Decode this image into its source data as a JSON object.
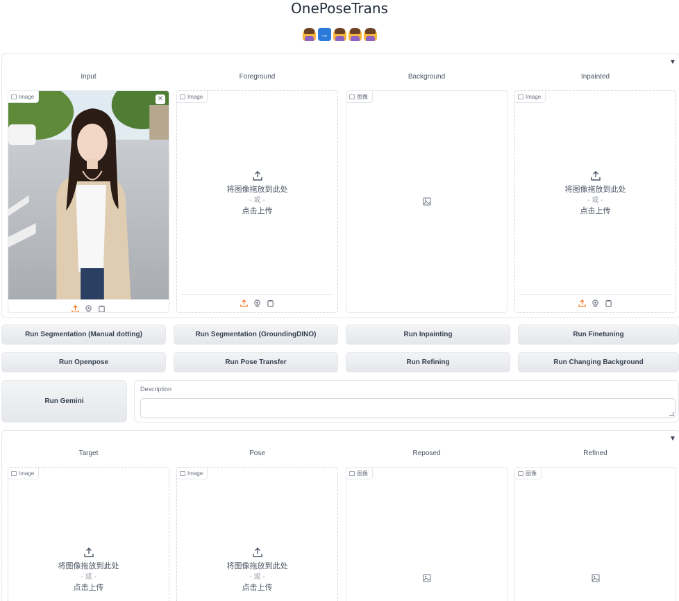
{
  "app": {
    "title": "OnePoseTrans"
  },
  "emojis": [
    "person-with-veil-emoji",
    "right-arrow-emoji",
    "person-standing-emoji",
    "person-gesturing-emoji",
    "person-raising-hand-emoji"
  ],
  "colors": {
    "accent": "#f97316",
    "border": "#e5e7eb",
    "button_bg": "#e5e7eb"
  },
  "section1": {
    "collapse_glyph": "▼",
    "columns": [
      {
        "label": "Input",
        "tag": "Image",
        "state": "filled"
      },
      {
        "label": "Foreground",
        "tag": "Image",
        "state": "upload"
      },
      {
        "label": "Background",
        "tag": "图像",
        "state": "empty"
      },
      {
        "label": "Inpainted",
        "tag": "Image",
        "state": "upload"
      }
    ]
  },
  "upload": {
    "line1": "将图像拖放到此处",
    "line2": "- 或 -",
    "line3": "点击上传"
  },
  "buttons": {
    "seg_manual": "Run Segmentation (Manual dotting)",
    "seg_grounding": "Run Segmentation (GroundingDINO)",
    "inpainting": "Run Inpainting",
    "finetuning": "Run Finetuning",
    "openpose": "Run Openpose",
    "pose_transfer": "Run Pose Transfer",
    "refining": "Run Refining",
    "changing_bg": "Run Changing Background",
    "gemini": "Run Gemini"
  },
  "description": {
    "label": "Description",
    "value": ""
  },
  "section2": {
    "collapse_glyph": "▼",
    "columns": [
      {
        "label": "Target",
        "tag": "Image",
        "state": "upload"
      },
      {
        "label": "Pose",
        "tag": "Image",
        "state": "upload"
      },
      {
        "label": "Reposed",
        "tag": "图像",
        "state": "empty"
      },
      {
        "label": "Refined",
        "tag": "图像",
        "state": "empty"
      }
    ]
  }
}
